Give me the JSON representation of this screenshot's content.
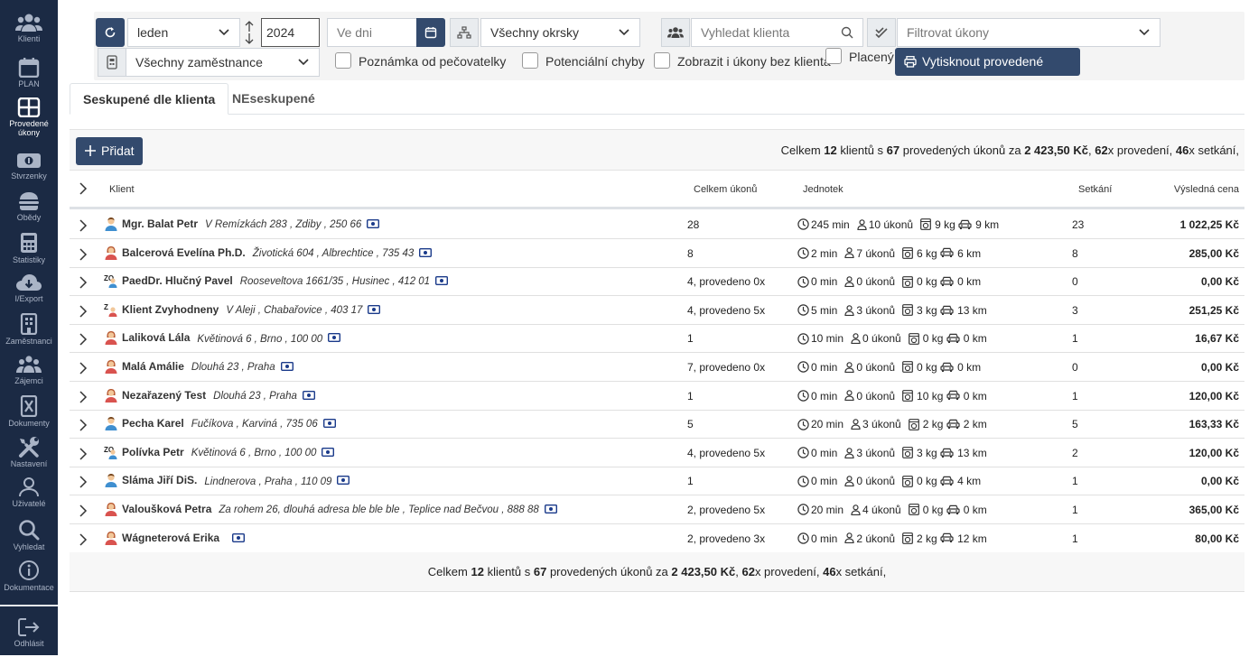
{
  "sidebar": {
    "items": [
      {
        "label": "Klienti",
        "icon": "users-icon"
      },
      {
        "label": "PLAN",
        "icon": "calendar-icon"
      },
      {
        "label": "Provedené úkony",
        "icon": "grid-icon",
        "active": true
      },
      {
        "label": "Stvrzenky",
        "icon": "money-icon"
      },
      {
        "label": "Obědy",
        "icon": "burger-icon"
      },
      {
        "label": "Statistiky",
        "icon": "calculator-icon"
      },
      {
        "label": "I/Export",
        "icon": "cloud-icon"
      },
      {
        "label": "Zaměstnanci",
        "icon": "building-icon"
      },
      {
        "label": "Zájemci",
        "icon": "group-icon"
      },
      {
        "label": "Dokumenty",
        "icon": "document-icon"
      },
      {
        "label": "Nastavení",
        "icon": "tools-icon"
      },
      {
        "label": "Uživatelé",
        "icon": "user-icon"
      },
      {
        "label": "Vyhledat",
        "icon": "search-icon"
      },
      {
        "label": "Dokumentace",
        "icon": "info-icon"
      },
      {
        "label": "Odhlásit",
        "icon": "logout-icon"
      }
    ]
  },
  "filters": {
    "month": "leden",
    "year": "2024",
    "days_placeholder": "Ve dni",
    "districts": "Všechny okrsky",
    "client_search_placeholder": "Vyhledat klienta",
    "tasks_filter_placeholder": "Filtrovat úkony",
    "employees": "Všechny zaměstnance",
    "check_note": "Poznámka od pečovatelky",
    "check_errors": "Potenciální chyby",
    "check_without_client": "Zobrazit i úkony bez klienta",
    "check_paid": "Placený",
    "print_label": "Vytisknout provedené úkony"
  },
  "tabs": [
    {
      "label": "Seskupené dle klienta",
      "active": true
    },
    {
      "label": "NEseskupené",
      "active": false
    }
  ],
  "toolbar": {
    "add_label": "Přidat",
    "summary": {
      "prefix": "Celkem ",
      "clients": "12",
      "mid1": " klientů s ",
      "tasks": "67",
      "mid2": " provedených úkonů za ",
      "price": "2 423,50 Kč",
      "mid3": ", ",
      "executions": "62",
      "mid4": "x provedení, ",
      "meetings": "46",
      "mid5": "x setkání,"
    }
  },
  "table": {
    "headers": {
      "client": "Klient",
      "tasks": "Celkem úkonů",
      "units": "Jednotek",
      "meetings": "Setkání",
      "price": "Výsledná cena"
    },
    "rows": [
      {
        "avatar": "male",
        "name": "Mgr. Balat Petr",
        "address": "V Remízkách 283 , Zdiby , 250 66",
        "tasks": "28",
        "min": "245 min",
        "ukony": "10 úkonů",
        "kg": "9 kg",
        "km": "9 km",
        "meetings": "23",
        "price": "1 022,25 Kč"
      },
      {
        "avatar": "female",
        "name": "Balcerová Evelína Ph.D.",
        "address": "Životická 604 , Albrechtice , 735 43",
        "tasks": "8",
        "min": "2 min",
        "ukony": "7 úkonů",
        "kg": "6 kg",
        "km": "6 km",
        "meetings": "8",
        "price": "285,00 Kč"
      },
      {
        "avatar": "zo",
        "name": "PaedDr. Hlučný Pavel",
        "address": "Rooseveltova 1661/35 , Husinec , 412 01",
        "tasks": "4, provedeno 0x",
        "min": "0 min",
        "ukony": "0 úkonů",
        "kg": "0 kg",
        "km": "0 km",
        "meetings": "0",
        "price": "0,00 Kč"
      },
      {
        "avatar": "z",
        "name": "Klient Zvyhodneny",
        "address": "V Aleji , Chabařovice , 403 17",
        "tasks": "4, provedeno 5x",
        "min": "5 min",
        "ukony": "3 úkonů",
        "kg": "3 kg",
        "km": "13 km",
        "meetings": "3",
        "price": "251,25 Kč"
      },
      {
        "avatar": "female",
        "name": "Laliková Lála",
        "address": "Květinová 6 , Brno , 100 00",
        "tasks": "1",
        "min": "10 min",
        "ukony": "0 úkonů",
        "kg": "0 kg",
        "km": "0 km",
        "meetings": "1",
        "price": "16,67 Kč"
      },
      {
        "avatar": "female",
        "name": "Malá Amálie",
        "address": "Dlouhá 23 , Praha",
        "tasks": "7, provedeno 0x",
        "min": "0 min",
        "ukony": "0 úkonů",
        "kg": "0 kg",
        "km": "0 km",
        "meetings": "0",
        "price": "0,00 Kč"
      },
      {
        "avatar": "female",
        "name": "Nezařazený Test",
        "address": "Dlouhá 23 , Praha",
        "tasks": "1",
        "min": "0 min",
        "ukony": "0 úkonů",
        "kg": "10 kg",
        "km": "0 km",
        "meetings": "1",
        "price": "120,00 Kč"
      },
      {
        "avatar": "male",
        "name": "Pecha Karel",
        "address": "Fučíkova , Karviná , 735 06",
        "tasks": "5",
        "min": "20 min",
        "ukony": "3 úkonů",
        "kg": "2 kg",
        "km": "2 km",
        "meetings": "5",
        "price": "163,33 Kč"
      },
      {
        "avatar": "zo",
        "name": "Polívka Petr",
        "address": "Květinová 6 , Brno , 100 00",
        "tasks": "4, provedeno 5x",
        "min": "0 min",
        "ukony": "3 úkonů",
        "kg": "3 kg",
        "km": "13 km",
        "meetings": "2",
        "price": "120,00 Kč"
      },
      {
        "avatar": "male",
        "name": "Sláma Jiří DiS.",
        "address": "Lindnerova , Praha , 110 09",
        "tasks": "1",
        "min": "0 min",
        "ukony": "0 úkonů",
        "kg": "0 kg",
        "km": "4 km",
        "meetings": "1",
        "price": "0,00 Kč"
      },
      {
        "avatar": "female",
        "name": "Valoušková Petra",
        "address": "Za rohem 26, dlouhá adresa ble ble ble , Teplice nad Bečvou , 888 88",
        "tasks": "2, provedeno 5x",
        "min": "20 min",
        "ukony": "4 úkonů",
        "kg": "0 kg",
        "km": "0 km",
        "meetings": "1",
        "price": "365,00 Kč"
      },
      {
        "avatar": "female",
        "name": "Wágneterová Erika",
        "address": "",
        "tasks": "2, provedeno 3x",
        "min": "0 min",
        "ukony": "2 úkonů",
        "kg": "2 kg",
        "km": "12 km",
        "meetings": "1",
        "price": "80,00 Kč"
      }
    ]
  },
  "colors": {
    "sidebar": "#1b2a44",
    "primary": "#334a6d",
    "money_icon": "#1a3a8a"
  }
}
